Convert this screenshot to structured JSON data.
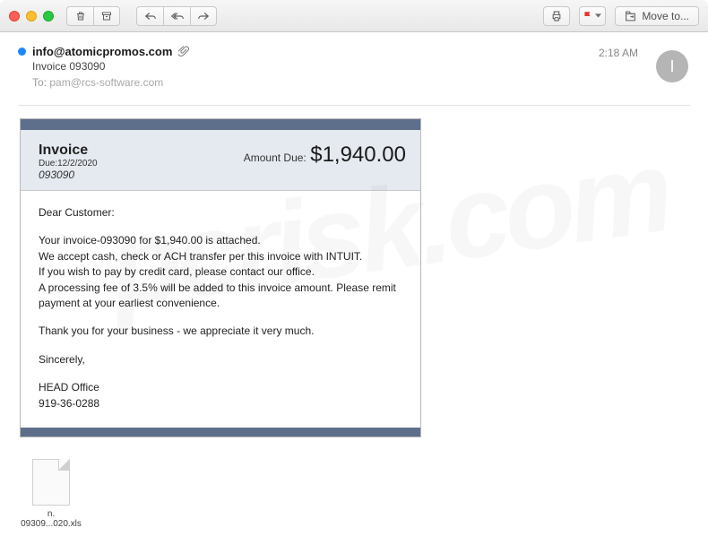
{
  "toolbar": {
    "move_label": "Move to..."
  },
  "header": {
    "sender": "info@atomicpromos.com",
    "subject": "Invoice 093090",
    "to_label": "To:",
    "to_value": "pam@rcs-software.com",
    "time": "2:18 AM",
    "avatar_initial": "I"
  },
  "invoice": {
    "title": "Invoice",
    "due_label": "Due:",
    "due_date": "12/2/2020",
    "number": "093090",
    "amount_label": "Amount Due:",
    "amount_value": "$1,940.00",
    "greeting": "Dear Customer:",
    "line1": "Your invoice-093090 for $1,940.00 is attached.",
    "line2": "We accept cash, check or ACH transfer per this invoice with INTUIT.",
    "line3": "If you wish to pay by credit card, please contact our office.",
    "line4": "A processing fee of 3.5% will be added to this invoice amount. Please remit payment at your earliest convenience.",
    "thanks": "Thank you for your business - we appreciate it very much.",
    "sign": "Sincerely,",
    "from1": "HEAD Office",
    "from2": "919-36-0288"
  },
  "attachments": {
    "file1_name": "n. 09309...020.xls"
  }
}
